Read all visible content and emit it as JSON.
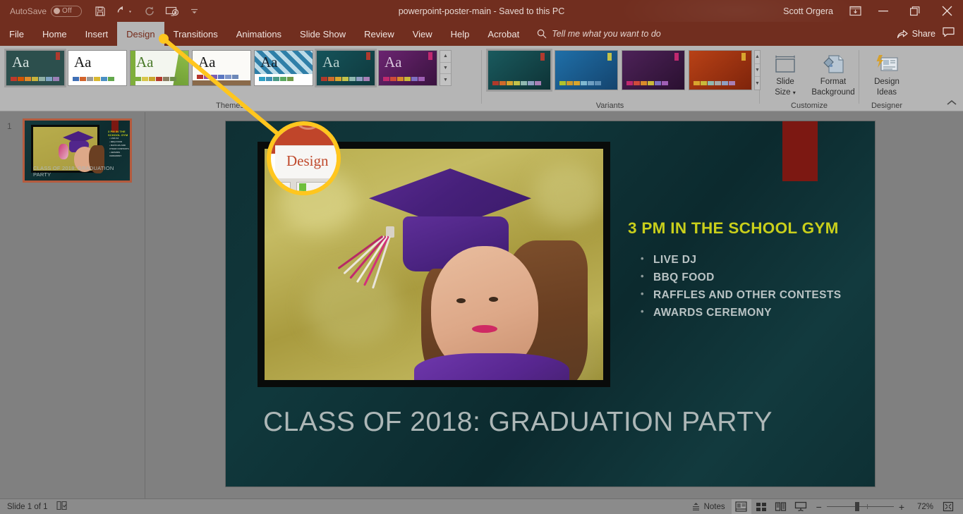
{
  "titlebar": {
    "autosave_label": "AutoSave",
    "autosave_state": "Off",
    "doc_title": "powerpoint-poster-main  -  Saved to this PC",
    "user_name": "Scott Orgera",
    "qat": [
      {
        "name": "save-icon",
        "tooltip": "Save"
      },
      {
        "name": "undo-icon",
        "tooltip": "Undo"
      },
      {
        "name": "redo-icon",
        "tooltip": "Redo"
      },
      {
        "name": "start-presentation-icon",
        "tooltip": "Start From Beginning"
      },
      {
        "name": "customize-qat-icon",
        "tooltip": "Customize Quick Access Toolbar"
      }
    ],
    "window_buttons": [
      "minimize",
      "restore",
      "close"
    ],
    "ribbon_display_options": "Ribbon Display Options"
  },
  "tabs": [
    {
      "label": "File",
      "active": false
    },
    {
      "label": "Home",
      "active": false
    },
    {
      "label": "Insert",
      "active": false
    },
    {
      "label": "Design",
      "active": true
    },
    {
      "label": "Transitions",
      "active": false
    },
    {
      "label": "Animations",
      "active": false
    },
    {
      "label": "Slide Show",
      "active": false
    },
    {
      "label": "Review",
      "active": false
    },
    {
      "label": "View",
      "active": false
    },
    {
      "label": "Help",
      "active": false
    },
    {
      "label": "Acrobat",
      "active": false
    }
  ],
  "tellme": {
    "placeholder": "Tell me what you want to do"
  },
  "share": {
    "label": "Share"
  },
  "ribbon": {
    "groups": [
      {
        "label": "Themes"
      },
      {
        "label": "Variants"
      },
      {
        "label": "Customize"
      },
      {
        "label": "Designer"
      }
    ],
    "themes": [
      {
        "name": "theme-1-office-dark-teal",
        "aa": "Aa",
        "bg": "#2c4f4d",
        "aa_color": "#d7e3e0",
        "selected": true,
        "swatches": [
          "#c0392b",
          "#d35400",
          "#e08b2a",
          "#c8b33a",
          "#8fb0a5",
          "#7da3c2",
          "#9b7fb5"
        ],
        "corner": "#b03a2e"
      },
      {
        "name": "theme-2-white",
        "aa": "Aa",
        "bg": "#ffffff",
        "aa_color": "#1a1a1a",
        "selected": false,
        "swatches": [
          "#3f6fb5",
          "#d2642c",
          "#9a9a9a",
          "#d9b831",
          "#4a90c4",
          "#63a84c"
        ],
        "corner": "#ffffff"
      },
      {
        "name": "theme-3-green-leaf",
        "aa": "Aa",
        "bg": "#f3f6ef",
        "aa_color": "#4a7a2a",
        "selected": false,
        "swatches": [
          "#7fae3b",
          "#d8c64a",
          "#c9a62e",
          "#b4382b",
          "#8a7f62",
          "#6f8f4a"
        ],
        "corner": "#7fae3b"
      },
      {
        "name": "theme-4-wood",
        "aa": "Aa",
        "bg": "#fbfaf7",
        "aa_color": "#1a1a1a",
        "selected": false,
        "swatches": [
          "#b5342c",
          "#9b4ba8",
          "#7a5fb5",
          "#5b77c2",
          "#7e95c9",
          "#6d88b8"
        ],
        "corner": "#8a6a4a"
      },
      {
        "name": "theme-5-blue-pattern",
        "aa": "Aa",
        "bg": "#2f7fa8",
        "aa_color": "#16202a",
        "selected": false,
        "swatches": [
          "#2f9fc4",
          "#3f8fb5",
          "#4a9a86",
          "#5aa85f",
          "#6f9a4a"
        ],
        "corner": "#2f7fa8"
      },
      {
        "name": "theme-6-teal-gradient",
        "aa": "Aa",
        "bg": "#12474a",
        "aa_color": "#b9d0cd",
        "selected": true,
        "swatches": [
          "#b0392b",
          "#cf6a2a",
          "#d8a52e",
          "#c3c24a",
          "#8fb8b0",
          "#8f9fc2",
          "#a87fb5"
        ],
        "corner": "#b03a2e"
      },
      {
        "name": "theme-7-purple-gradient",
        "aa": "Aa",
        "bg": "#5a2060",
        "aa_color": "#d9c6dd",
        "selected": false,
        "swatches": [
          "#c0296f",
          "#cf4a3a",
          "#d98a2a",
          "#c9b93a",
          "#7f6fc2",
          "#9f5fb5"
        ],
        "corner": "#c0296f"
      }
    ],
    "variants": [
      {
        "name": "variant-teal",
        "bg": "#12474a",
        "selected": true,
        "swatches": [
          "#b0392b",
          "#cf6a2a",
          "#d8a52e",
          "#c3c24a",
          "#8fb8b0",
          "#8f9fc2",
          "#a87fb5"
        ],
        "corner": "#b03a2e"
      },
      {
        "name": "variant-blue",
        "bg": "#17507e",
        "selected": false,
        "swatches": [
          "#b0c22b",
          "#cf9a2a",
          "#d8a52e",
          "#7fb8d0",
          "#6f9fc2",
          "#5f8fb5"
        ],
        "corner": "#c3c24a"
      },
      {
        "name": "variant-purple",
        "bg": "#3d1a46",
        "selected": false,
        "swatches": [
          "#c0296f",
          "#cf4a3a",
          "#d98a2a",
          "#c9b93a",
          "#7f6fc2",
          "#9f5fb5"
        ],
        "corner": "#c0296f"
      },
      {
        "name": "variant-orange",
        "bg": "#9c3211",
        "selected": false,
        "swatches": [
          "#d8a52e",
          "#c9b93a",
          "#8fb8b0",
          "#a8a8a8",
          "#8f9fc2",
          "#a87fb5"
        ],
        "corner": "#d8a52e"
      }
    ],
    "buttons": [
      {
        "name": "slide-size-button",
        "line1": "Slide",
        "line2": "Size",
        "has_dropdown": true
      },
      {
        "name": "format-background-button",
        "line1": "Format",
        "line2": "Background",
        "has_dropdown": false
      },
      {
        "name": "design-ideas-button",
        "line1": "Design",
        "line2": "Ideas",
        "has_dropdown": false
      }
    ]
  },
  "slide_panel": {
    "slide_number": "1"
  },
  "slide": {
    "heading": "3 PM IN THE SCHOOL GYM",
    "bullets": [
      "LIVE DJ",
      "BBQ FOOD",
      "RAFFLES AND OTHER CONTESTS",
      "AWARDS CEREMONY"
    ],
    "title": "CLASS OF 2018:  GRADUATION PARTY",
    "heading_color": "#c9cf1b",
    "bullet_color": "#b9c3c4",
    "title_color": "#adb7b7",
    "accent_color": "#7c1812",
    "background_color": "#0f3034"
  },
  "callout": {
    "magnified_label": "Design",
    "highlight_color": "#ffc61e",
    "tab_text_color": "#c04a2d"
  },
  "statusbar": {
    "slide_indicator": "Slide 1 of 1",
    "accessibility_icon": "accessibility-checker-icon",
    "notes_label": "Notes",
    "views": [
      {
        "name": "normal-view-button",
        "active": true
      },
      {
        "name": "slide-sorter-view-button",
        "active": false
      },
      {
        "name": "reading-view-button",
        "active": false
      },
      {
        "name": "slide-show-view-button",
        "active": false
      }
    ],
    "zoom_out_label": "−",
    "zoom_in_label": "+",
    "zoom_level": "72%",
    "fit_slide_icon": "fit-slide-to-window-icon"
  }
}
